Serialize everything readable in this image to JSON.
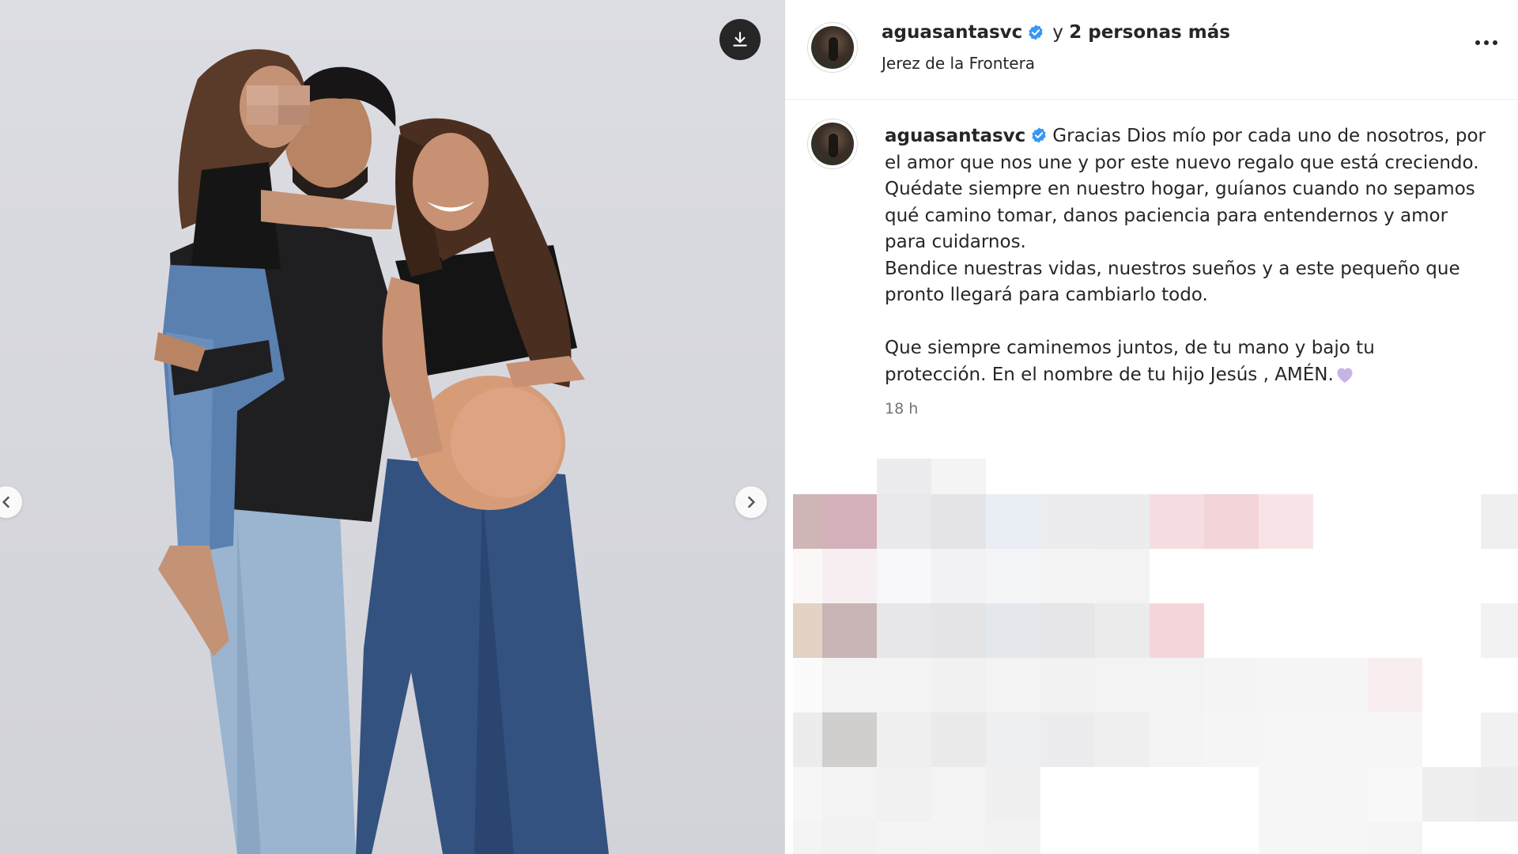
{
  "post": {
    "username": "aguasantasvc",
    "others_prefix": "y",
    "others_count": "2 personas más",
    "location": "Jerez de la Frontera",
    "caption_lines": [
      "Gracias Dios mío por cada uno de nosotros, por",
      "el amor que nos une y por este nuevo regalo que está creciendo.",
      "Quédate siempre en nuestro hogar, guíanos cuando no sepamos",
      "qué camino tomar, danos paciencia para entendernos y amor",
      "para cuidarnos.",
      "Bendice nuestras vidas, nuestros sueños y a este pequeño que",
      "pronto llegará para cambiarlo todo.",
      "",
      "Que siempre caminemos juntos, de tu mano y bajo tu",
      "protección. En el nombre de tu hijo Jesús , AMÉN."
    ],
    "timestamp": "18 h"
  },
  "icons": {
    "download": "download-icon",
    "prev": "chevron-left-icon",
    "next": "chevron-right-icon",
    "verified": "verified-badge-icon",
    "more": "more-options-icon",
    "heart": "purple-heart-emoji"
  },
  "colors": {
    "verified": "#3897f0",
    "heart": "#c7b3e6",
    "text": "#262626",
    "muted": "#737373",
    "background_photo": "#d8d9df"
  }
}
